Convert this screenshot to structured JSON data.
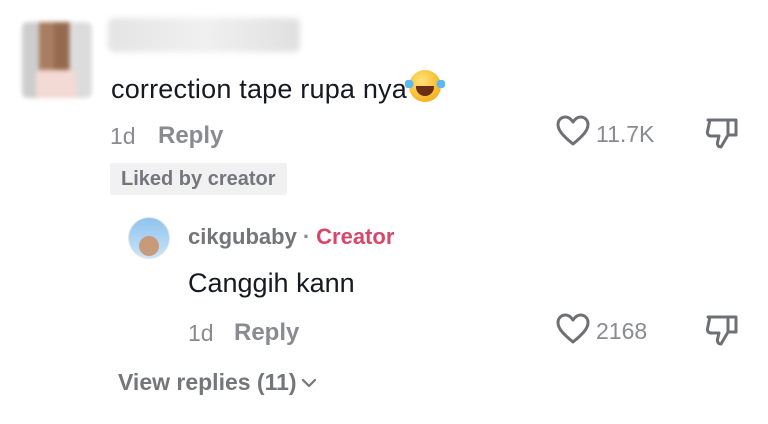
{
  "top_comment": {
    "text": "correction tape rupa nya",
    "emoji": "tears-of-joy",
    "time": "1d",
    "reply_label": "Reply",
    "likes": "11.7K",
    "badge": "Liked by creator"
  },
  "reply_comment": {
    "username": "cikgubaby",
    "separator": "·",
    "role": "Creator",
    "text": "Canggih kann",
    "time": "1d",
    "reply_label": "Reply",
    "likes": "2168"
  },
  "view_replies": "View replies (11)",
  "colors": {
    "creator": "#d7476a",
    "muted": "#8a8b91",
    "text": "#161823"
  }
}
